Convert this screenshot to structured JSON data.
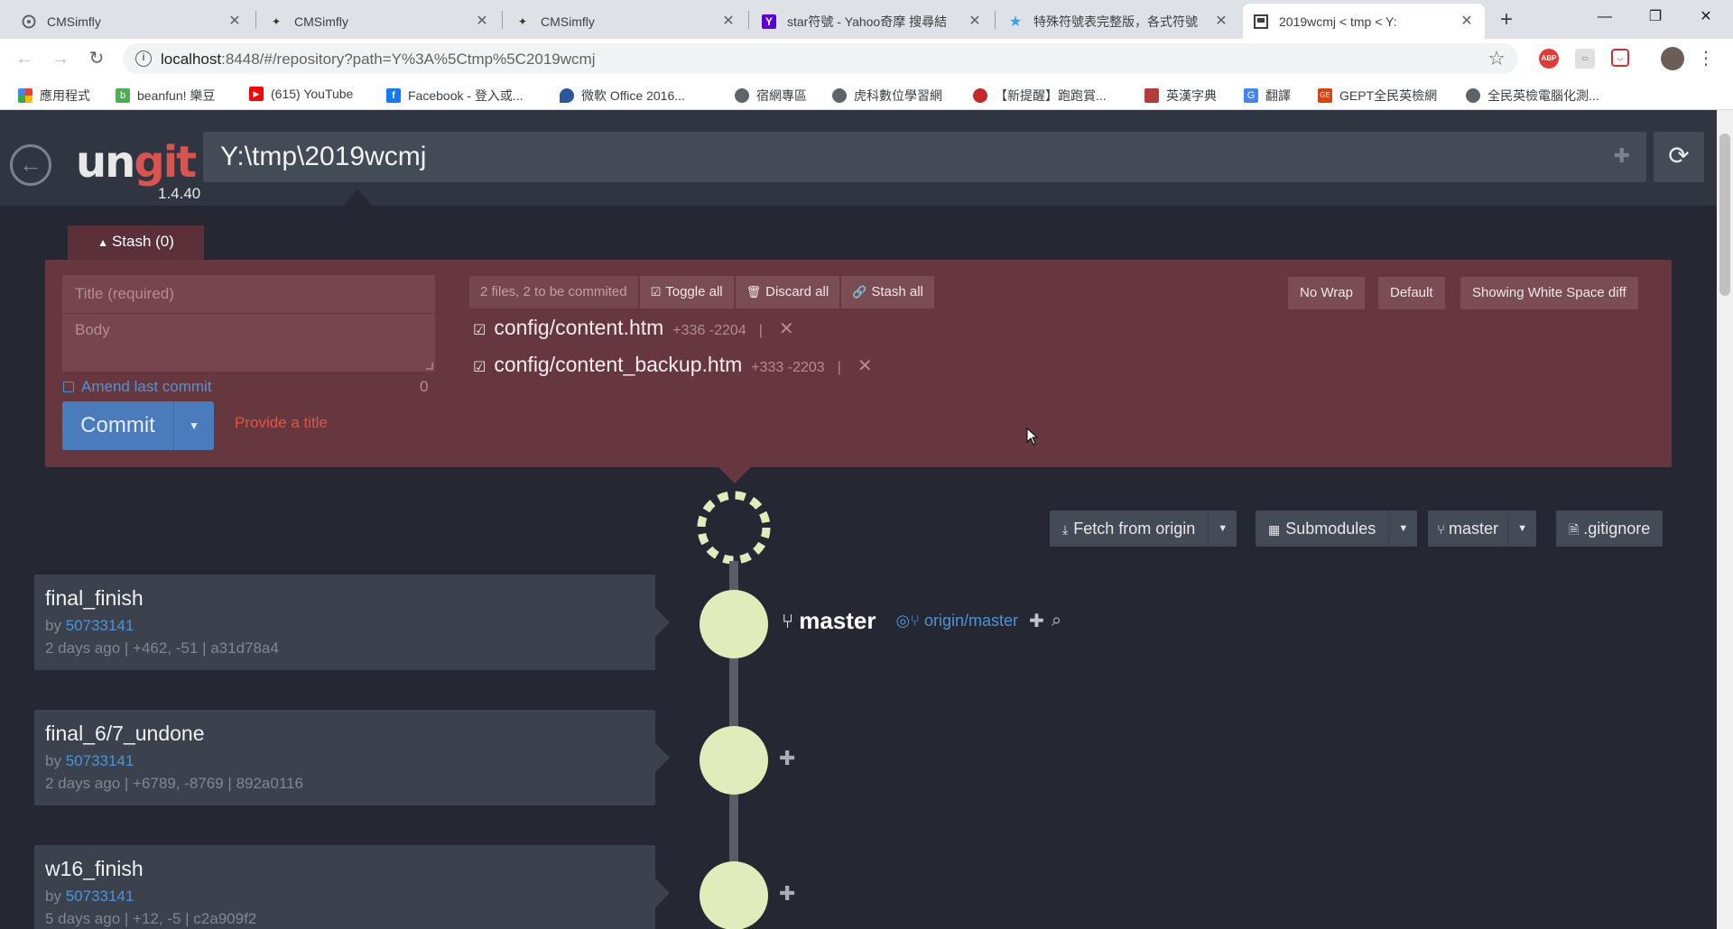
{
  "browser": {
    "tabs": [
      {
        "title": "CMSimfly",
        "icon": "cmsimfly-icon",
        "active": false
      },
      {
        "title": "CMSimfly",
        "icon": "cmsimfly-icon",
        "active": false
      },
      {
        "title": "CMSimfly",
        "icon": "cmsimfly-icon",
        "active": false
      },
      {
        "title": "star符號 - Yahoo奇摩 搜尋結",
        "icon": "yahoo-icon",
        "active": false
      },
      {
        "title": "特殊符號表完整版，各式符號",
        "icon": "star-icon",
        "active": false
      },
      {
        "title": "2019wcmj < tmp < Y:",
        "icon": "ungit-icon",
        "active": true
      }
    ],
    "url_host": "localhost",
    "url_rest": ":8448/#/repository?path=Y%3A%5Ctmp%5C2019wcmj",
    "bookmarks": [
      {
        "label": "應用程式",
        "icon": "apps-icon",
        "color": "#ea4335"
      },
      {
        "label": "beanfun! 樂豆",
        "icon": "beanfun-icon",
        "color": "#4caf50"
      },
      {
        "label": "(615) YouTube",
        "icon": "youtube-icon",
        "color": "#ff0000"
      },
      {
        "label": "Facebook - 登入或...",
        "icon": "facebook-icon",
        "color": "#1877f2"
      },
      {
        "label": "微軟 Office 2016...",
        "icon": "office-icon",
        "color": "#2b579a"
      },
      {
        "label": "宿網專區",
        "icon": "globe-icon",
        "color": "#5f6368"
      },
      {
        "label": "虎科數位學習網",
        "icon": "globe-icon",
        "color": "#5f6368"
      },
      {
        "label": "【新提醒】跑跑賞...",
        "icon": "game-icon",
        "color": "#c62828"
      },
      {
        "label": "英漢字典",
        "icon": "dictionary-icon",
        "color": "#b23b3b"
      },
      {
        "label": "翻譯",
        "icon": "translate-icon",
        "color": "#4285f4"
      },
      {
        "label": "GEPT全民英檢網",
        "icon": "gept-icon",
        "color": "#d84315"
      },
      {
        "label": "全民英檢電腦化測...",
        "icon": "globe-icon",
        "color": "#5f6368"
      }
    ]
  },
  "ungit": {
    "version": "1.4.40",
    "repo_path": "Y:\\tmp\\2019wcmj",
    "stash_label": "Stash (0)",
    "commit_form": {
      "title_placeholder": "Title (required)",
      "body_placeholder": "Body",
      "amend_label": "Amend last commit",
      "char_count": "0",
      "commit_label": "Commit",
      "warning": "Provide a title"
    },
    "file_toolbar": {
      "summary": "2 files, 2 to be commited",
      "toggle_all": "Toggle all",
      "discard_all": "Discard all",
      "stash_all": "Stash all"
    },
    "files": [
      {
        "name": "config/content.htm",
        "added": "+336",
        "removed": "-2204"
      },
      {
        "name": "config/content_backup.htm",
        "added": "+333",
        "removed": "-2203"
      }
    ],
    "view_options": {
      "wrap": "No Wrap",
      "diff_mode": "Default",
      "whitespace": "Showing White Space diff"
    },
    "repo_actions": {
      "fetch": "Fetch from origin",
      "submodules": "Submodules",
      "branch": "master",
      "gitignore": ".gitignore"
    },
    "head": {
      "branch": "master",
      "remote": "origin/master"
    },
    "commits": [
      {
        "title": "final_finish",
        "by": "by",
        "author": "50733141",
        "meta": "2 days ago | +462, -51 | a31d78a4"
      },
      {
        "title": "final_6/7_undone",
        "by": "by",
        "author": "50733141",
        "meta": "2 days ago | +6789, -8769 | 892a0116"
      },
      {
        "title": "w16_finish",
        "by": "by",
        "author": "50733141",
        "meta": "5 days ago | +12, -5 | c2a909f2"
      }
    ],
    "colors": {
      "staging_bg": "#66373f",
      "node_fill": "#e0ecba",
      "link_blue": "#4f93d6",
      "warning_red": "#e2553d"
    }
  }
}
